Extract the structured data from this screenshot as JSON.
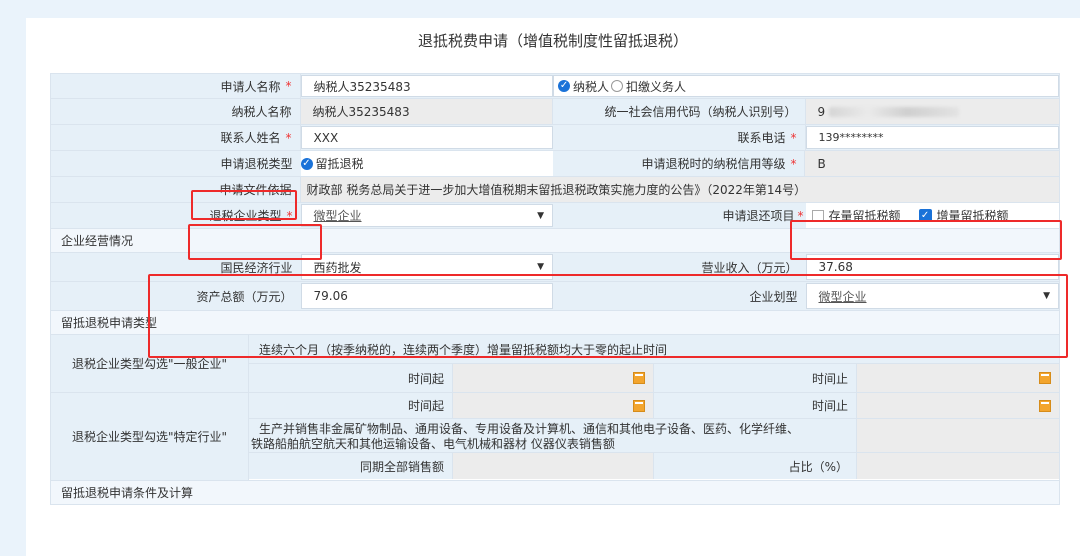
{
  "title": "退抵税费申请（增值税制度性留抵退税）",
  "row1": {
    "label": "申请人名称",
    "value": "纳税人35235483",
    "option_taxpayer": "纳税人",
    "option_withholding": "扣缴义务人"
  },
  "row2": {
    "label": "纳税人名称",
    "value": "纳税人35235483",
    "credit_code_label": "统一社会信用代码（纳税人识别号）",
    "credit_code_prefix": "9"
  },
  "row3": {
    "label": "联系人姓名",
    "value": "XXX",
    "phone_label": "联系电话",
    "phone_value": "139********"
  },
  "row4": {
    "label": "申请退税类型",
    "value": "留抵退税",
    "credit_level_label": "申请退税时的纳税信用等级",
    "credit_level_value": "B"
  },
  "row5": {
    "label": "申请文件依据",
    "value": "财政部 税务总局关于进一步加大增值税期末留抵退税政策实施力度的公告》（2022年第14号）"
  },
  "row6": {
    "label": "退税企业类型",
    "value": "微型企业",
    "refund_items_label": "申请退还项目",
    "stock_label": "存量留抵税额",
    "increment_label": "增量留抵税额"
  },
  "section_business": "企业经营情况",
  "biz1": {
    "industry_label": "国民经济行业",
    "industry_value": "西药批发",
    "revenue_label": "营业收入（万元）",
    "revenue_value": "37.68"
  },
  "biz2": {
    "assets_label": "资产总额（万元）",
    "assets_value": "79.06",
    "size_label": "企业划型",
    "size_value": "微型企业"
  },
  "section_type": "留抵退税申请类型",
  "general": {
    "label": "退税企业类型勾选\"一般企业\"",
    "desc": "连续六个月（按季纳税的，连续两个季度）增量留抵税额均大于零的起止时间",
    "start_label": "时间起",
    "end_label": "时间止"
  },
  "special": {
    "label": "退税企业类型勾选\"特定行业\"",
    "start_label": "时间起",
    "end_label": "时间止",
    "desc_line1": "生产并销售非金属矿物制品、通用设备、专用设备及计算机、通信和其他电子设备、医药、化学纤维、",
    "desc_line2": "铁路船舶航空航天和其他运输设备、电气机械和器材 仪器仪表销售额",
    "sales_label": "同期全部销售额",
    "ratio_label": "占比（%）"
  },
  "section_calc": "留抵退税申请条件及计算",
  "colors": {
    "required": "#ee3333",
    "highlight": "#ee2a2a",
    "checkbox": "#1a72d8",
    "calendar": "#f3a52e"
  }
}
